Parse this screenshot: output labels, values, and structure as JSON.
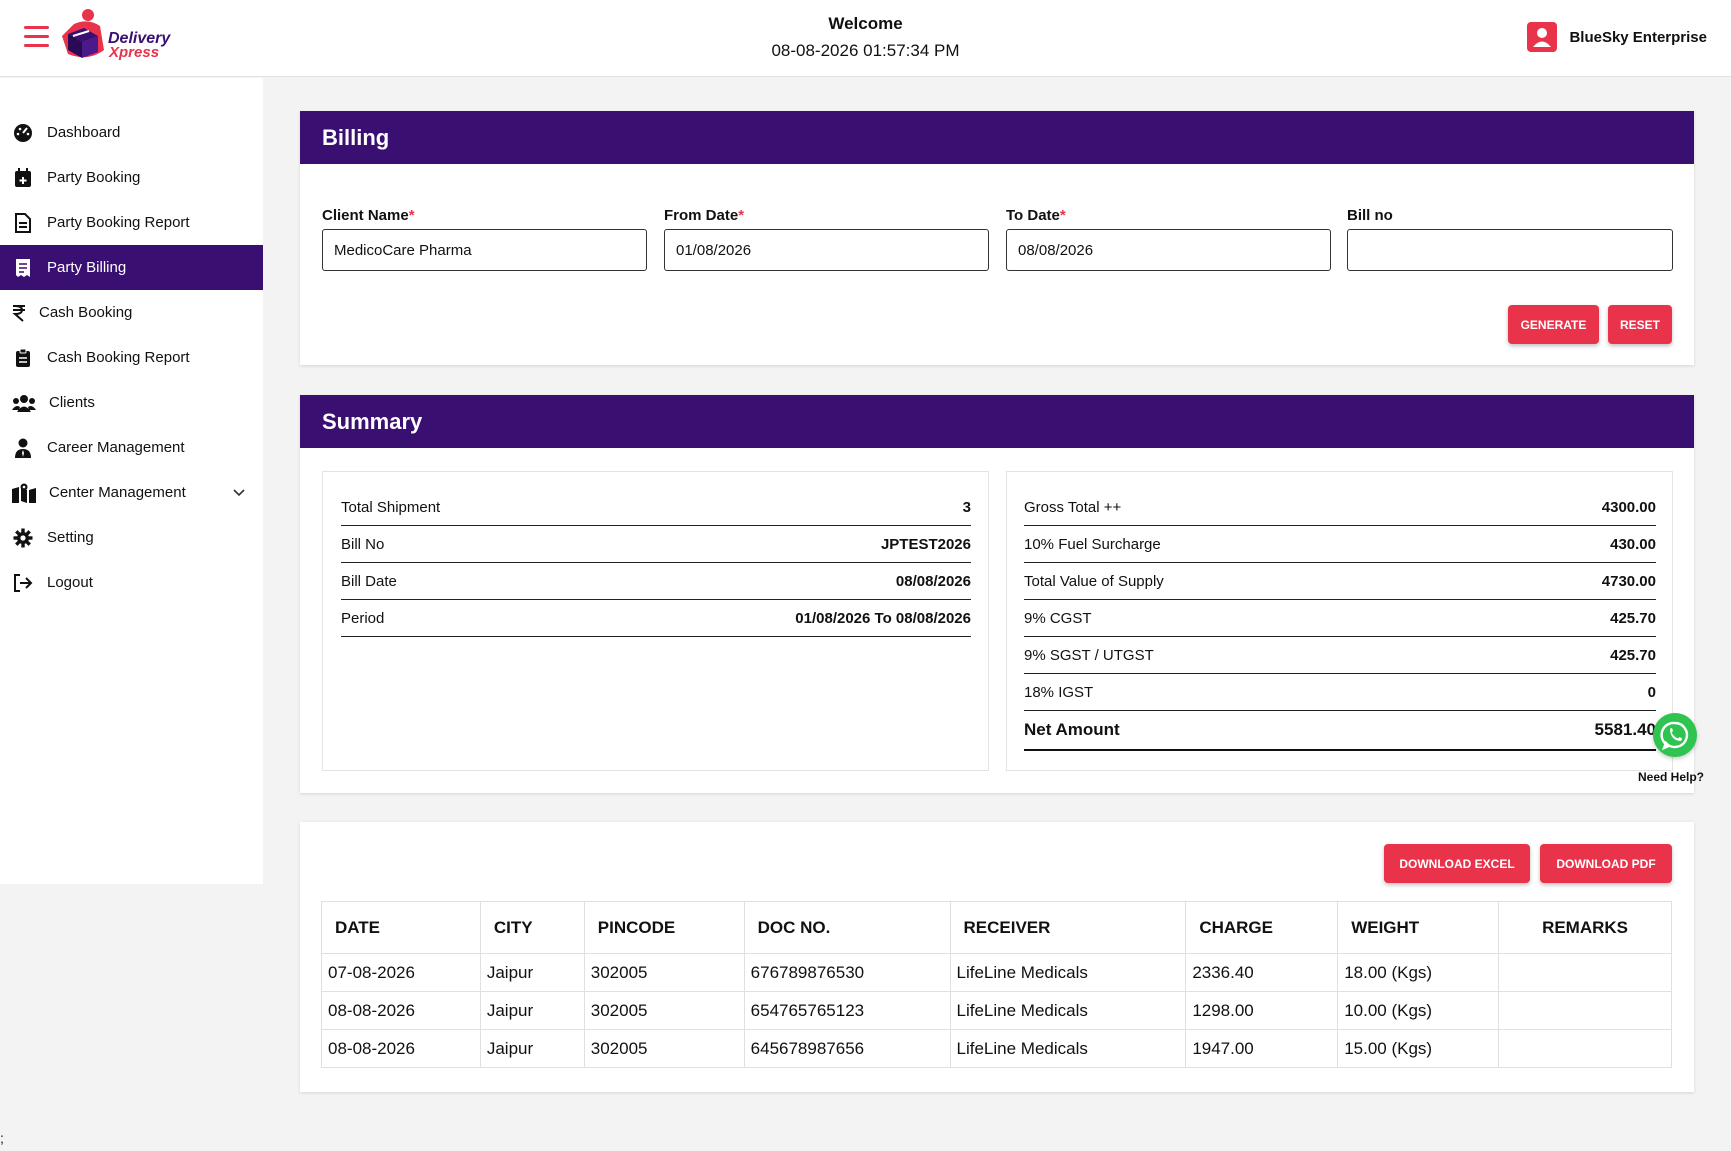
{
  "header": {
    "brand_line1": "Delivery",
    "brand_line2": "Xpress",
    "welcome": "Welcome",
    "datetime": "08-08-2026 01:57:34 PM",
    "user_name": "BlueSky Enterprise"
  },
  "sidebar": {
    "items": [
      {
        "label": "Dashboard",
        "icon": "dashboard-icon"
      },
      {
        "label": "Party Booking",
        "icon": "calendar-plus-icon"
      },
      {
        "label": "Party Booking Report",
        "icon": "file-icon"
      },
      {
        "label": "Party Billing",
        "icon": "receipt-icon",
        "active": true
      },
      {
        "label": "Cash Booking",
        "icon": "rupee-icon"
      },
      {
        "label": "Cash Booking Report",
        "icon": "clipboard-icon"
      },
      {
        "label": "Clients",
        "icon": "users-icon"
      },
      {
        "label": "Career Management",
        "icon": "user-tie-icon"
      },
      {
        "label": "Center Management",
        "icon": "map-icon"
      },
      {
        "label": "Setting",
        "icon": "gear-icon"
      },
      {
        "label": "Logout",
        "icon": "logout-icon"
      }
    ]
  },
  "billing": {
    "title": "Billing",
    "client_label": "Client Name",
    "client_value": "MedicoCare Pharma",
    "from_label": "From Date",
    "from_value": "01/08/2026",
    "to_label": "To Date",
    "to_value": "08/08/2026",
    "bill_label": "Bill no",
    "bill_value": "",
    "required_mark": "*",
    "generate_label": "GENERATE",
    "reset_label": "RESET"
  },
  "summary": {
    "title": "Summary",
    "left": [
      {
        "label": "Total Shipment",
        "value": "3"
      },
      {
        "label": "Bill No",
        "value": "JPTEST2026"
      },
      {
        "label": "Bill Date",
        "value": "08/08/2026"
      },
      {
        "label": "Period",
        "value": "01/08/2026 To 08/08/2026"
      }
    ],
    "right": [
      {
        "label": "Gross Total ++",
        "value": "4300.00"
      },
      {
        "label": "10% Fuel Surcharge",
        "value": "430.00"
      },
      {
        "label": "Total Value of Supply",
        "value": "4730.00"
      },
      {
        "label": "9% CGST",
        "value": "425.70"
      },
      {
        "label": "9% SGST / UTGST",
        "value": "425.70"
      },
      {
        "label": "18% IGST",
        "value": "0"
      },
      {
        "label": "Net Amount",
        "value": "5581.40"
      }
    ]
  },
  "details": {
    "download_excel": "DOWNLOAD EXCEL",
    "download_pdf": "DOWNLOAD PDF",
    "columns": [
      "DATE",
      "CITY",
      "PINCODE",
      "DOC NO.",
      "RECEIVER",
      "CHARGE",
      "WEIGHT",
      "REMARKS"
    ],
    "rows": [
      [
        "07-08-2026",
        "Jaipur",
        "302005",
        "676789876530",
        "LifeLine Medicals",
        "2336.40",
        "18.00 (Kgs)",
        ""
      ],
      [
        "08-08-2026",
        "Jaipur",
        "302005",
        "654765765123",
        "LifeLine Medicals",
        "1298.00",
        "10.00 (Kgs)",
        ""
      ],
      [
        "08-08-2026",
        "Jaipur",
        "302005",
        "645678987656",
        "LifeLine Medicals",
        "1947.00",
        "15.00 (Kgs)",
        ""
      ]
    ]
  },
  "help": {
    "label": "Need Help?",
    "icon": "whatsapp-icon"
  },
  "stray_text": ";",
  "colors": {
    "primary": "#3a0f72",
    "accent": "#e8334a",
    "whatsapp": "#2fc44f"
  }
}
